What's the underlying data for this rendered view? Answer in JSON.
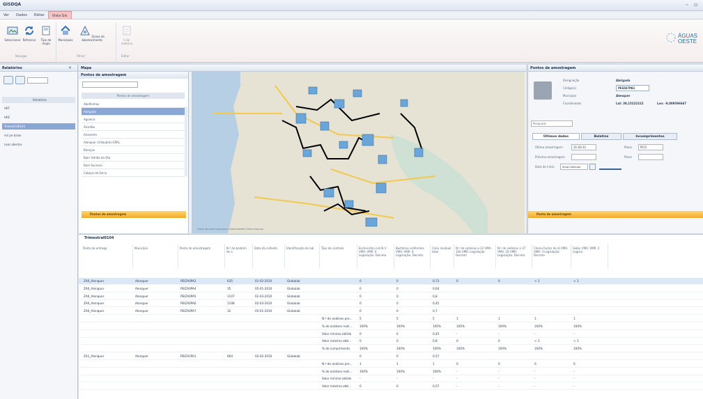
{
  "app": {
    "title": "GISDQA"
  },
  "menu": {
    "items": [
      "Ver",
      "Dados",
      "Editar",
      "Vista Gis"
    ]
  },
  "ribbon": {
    "buttons": [
      "Seleccionar",
      "Refrescar",
      "Tipo de mapa",
      "Municípios",
      "Zonas de abastecimento",
      "Criar relatório"
    ],
    "groups": [
      "Navegar",
      "Filtrar",
      "Editar"
    ],
    "logo_line1": "ÁGUAS",
    "logo_line2": "OESTE"
  },
  "left": {
    "title": "Relatórios",
    "items": [
      "Relatórios",
      "HKT",
      "HKE",
      "Trimestral0104",
      "mil pe baixo",
      "Loos abertos"
    ]
  },
  "map_panel": {
    "tab": "Mapa",
    "list_title": "Pontos de amostragem",
    "list_header": "Pontos de amostragem",
    "points": [
      "Abelhinhas",
      "Abrigada",
      "Aguieira",
      "Alcoitão",
      "Alcoentre",
      "Alenquer (Villaubim) EPAL",
      "Baraças",
      "Bairr Adrião da Ota",
      "Bom Sucesso",
      "Cabeço da Serra"
    ],
    "footer": "Pontos de amostragem",
    "map_copyright": "©2011 Microsoft Corporation ©2010 NAVTEQ ©2011 Intermap"
  },
  "right": {
    "title": "Pontos de amostragem",
    "designacao_label": "Designação",
    "designacao": "Abrigada",
    "codigo_label": "Código(s)",
    "codigo": "PEIZA7PA1",
    "municipio_label": "Município",
    "municipio": "Alenquer",
    "coords_label": "Coordenadas",
    "lat": "Lat: 39,15222222",
    "lon": "Lon: -9,009596667",
    "search_placeholder": "Pesquisar",
    "tabs": [
      "Últimos dados",
      "Boletins",
      "Incumprimentos"
    ],
    "ultima_label": "Última amostragem",
    "ultima": "11-03-11",
    "plano_label": "Plano",
    "plano": "PCCI",
    "proxima_label": "Próxima amostragem",
    "data_label": "Data de início",
    "calendar_label": "Show Calendar",
    "footer": "Ponto de amostragem"
  },
  "table": {
    "title": "Trimestral0104",
    "headers": [
      "Ponto de entrega",
      "Município",
      "Ponto de amostragem",
      "N.º do boletim de a",
      "Data da colheita",
      "Identificação do lab",
      "Tipo de controlo",
      "Escherichia coli N.º/ VMA: VMR: 0 Legislação: Decreto",
      "Bactérias coliformes VMA: VMR: 0 Legislação: Decreto",
      "Cloro residual total",
      "N.º de colónias a 22 VMA: 100 VMR: Legislação: Decreto",
      "N.º de colónias a 37 VMA: 20 VMR: Legislação: Decreto",
      "Cheiro Factor de di VMA: VMR: 3 Legislação: Decreto",
      "Sabor VMA: VMR: 3 Legisla"
    ],
    "rows": [
      [
        "ZA0_Alenquer",
        "Alenquer",
        "PEIZA0PA2",
        "635",
        "01-02-2010",
        "Globalab",
        "",
        "0",
        "0",
        "0,73",
        "0",
        "0",
        "< 3",
        "< 3"
      ],
      [
        "ZA0_Alenquer",
        "Alenquer",
        "PEIZA0PA4",
        "35",
        "05-01-2010",
        "Globalab",
        "",
        "0",
        "0",
        "0,64",
        "",
        "",
        "",
        ""
      ],
      [
        "ZA0_Alenquer",
        "Alenquer",
        "PEIZA0PA5",
        "1107",
        "02-03-2010",
        "Globalab",
        "",
        "0",
        "0",
        "0,8",
        "",
        "",
        "",
        ""
      ],
      [
        "ZA0_Alenquer",
        "Alenquer",
        "PEIZA0PA6",
        "1108",
        "02-03-2010",
        "Globalab",
        "",
        "0",
        "0",
        "0,45",
        "",
        "",
        "",
        ""
      ],
      [
        "ZA0_Alenquer",
        "Alenquer",
        "PEIZA0PA7",
        "32",
        "05-01-2010",
        "Globalab",
        "",
        "0",
        "0",
        "0,7",
        "",
        "",
        "",
        ""
      ],
      [
        "",
        "",
        "",
        "",
        "",
        "",
        "N.º de análises pre...",
        "5",
        "5",
        "5",
        "1",
        "1",
        "1",
        "1"
      ],
      [
        "",
        "",
        "",
        "",
        "",
        "",
        "% de análises reali...",
        "100%",
        "100%",
        "100%",
        "100%",
        "100%",
        "100%",
        "100%"
      ],
      [
        "",
        "",
        "",
        "",
        "",
        "",
        "Valor mínimo obtido",
        "0",
        "0",
        "0,45",
        "-",
        "-",
        "-",
        "-"
      ],
      [
        "",
        "",
        "",
        "",
        "",
        "",
        "Valor máximo obti...",
        "0",
        "0",
        "0,8",
        "0",
        "0",
        "< 3",
        "< 3"
      ],
      [
        "",
        "",
        "",
        "",
        "",
        "",
        "% de cumprimento",
        "100%",
        "100%",
        "100%",
        "100%",
        "100%",
        "100%",
        "100%"
      ],
      [
        "ZA1_Alenquer",
        "Alenquer",
        "PEIZA1PA1",
        "664",
        "02-02-2010",
        "Globalab",
        "",
        "0",
        "0",
        "0,57",
        "",
        "",
        "",
        ""
      ],
      [
        "",
        "",
        "",
        "",
        "",
        "",
        "N.º de análises pre...",
        "1",
        "1",
        "1",
        "0",
        "0",
        "0",
        "0"
      ],
      [
        "",
        "",
        "",
        "",
        "",
        "",
        "% de análises reali...",
        "100%",
        "100%",
        "100%",
        "-",
        "-",
        "-",
        "-"
      ],
      [
        "",
        "",
        "",
        "",
        "",
        "",
        "Valor mínimo obtido",
        "-",
        "-",
        "-",
        "-",
        "-",
        "-",
        "-"
      ],
      [
        "",
        "",
        "",
        "",
        "",
        "",
        "Valor máximo obti...",
        "0",
        "0",
        "0,57",
        "-",
        "-",
        "-",
        "-"
      ]
    ]
  }
}
